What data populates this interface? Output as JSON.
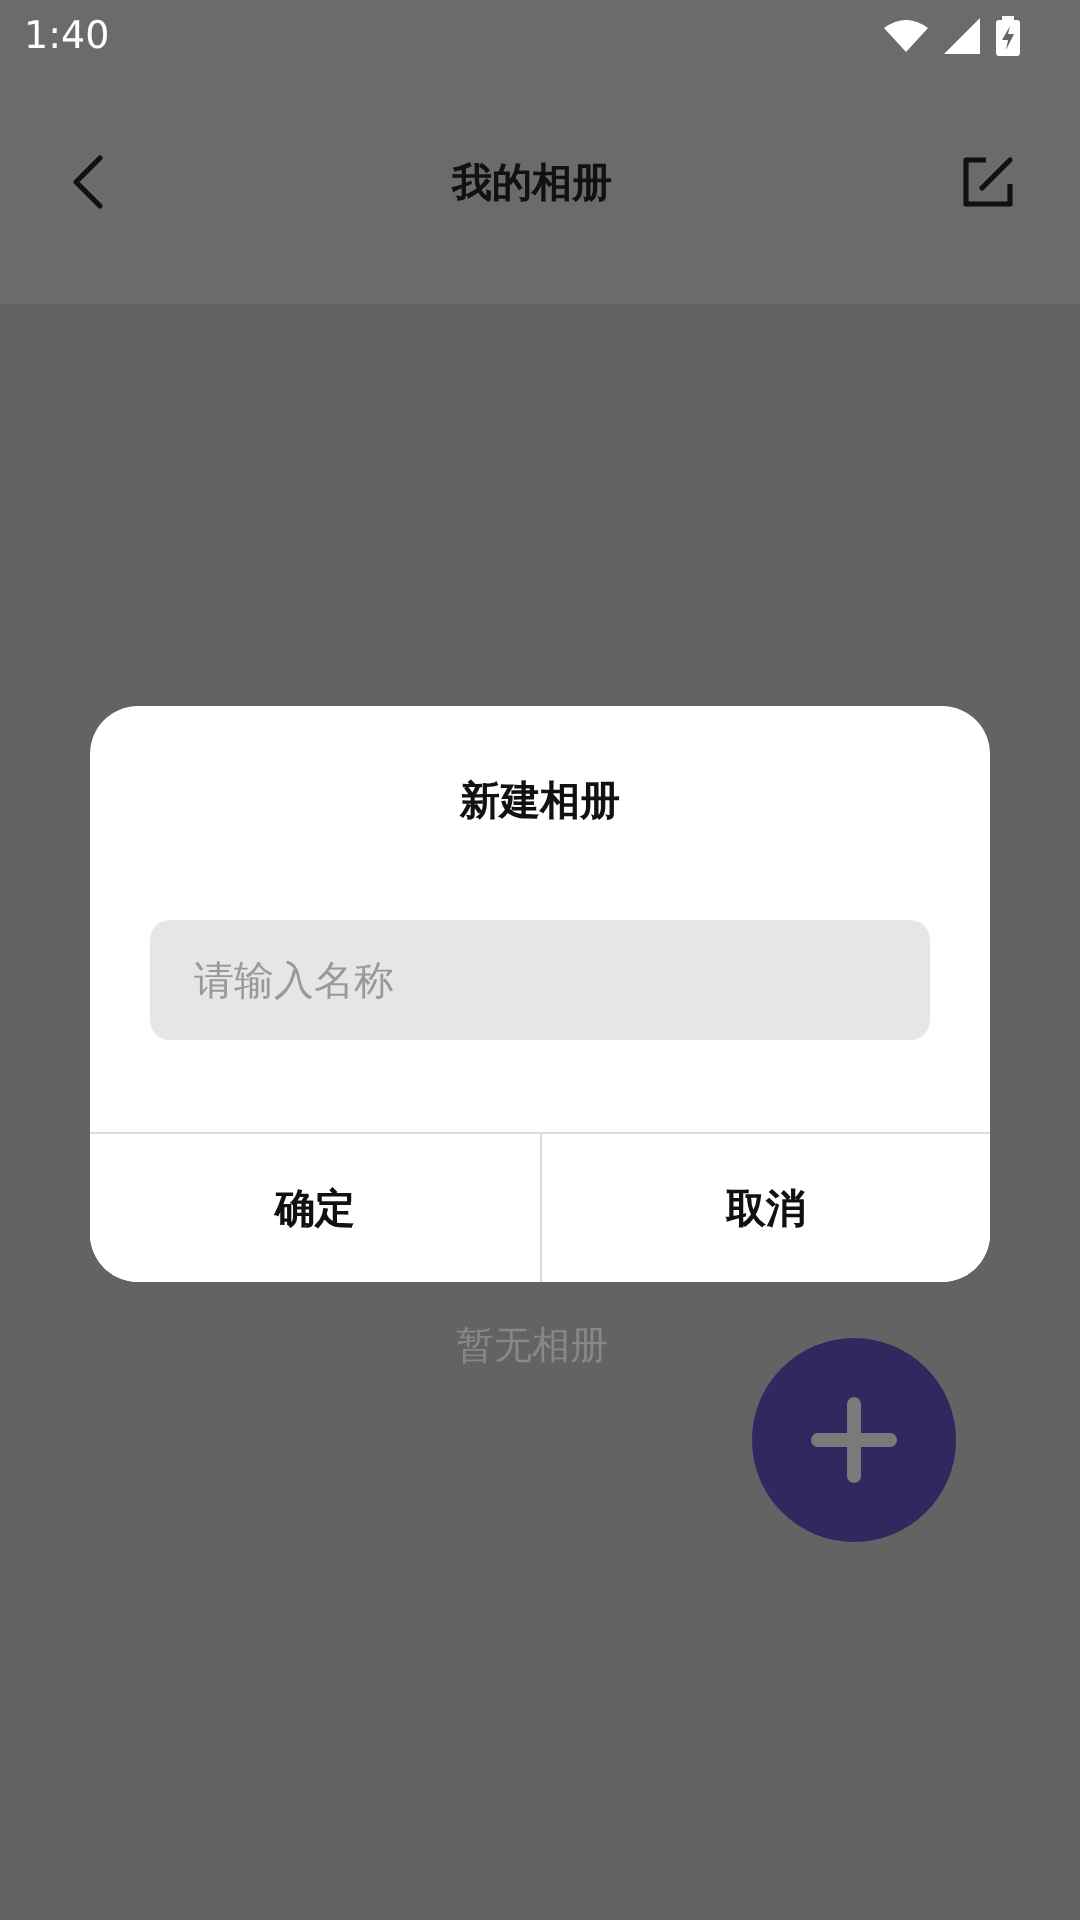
{
  "status_bar": {
    "time": "1:40"
  },
  "header": {
    "title": "我的相册"
  },
  "empty_state": {
    "text": "暂无相册"
  },
  "dialog": {
    "title": "新建相册",
    "input": {
      "placeholder": "请输入名称"
    },
    "buttons": [
      {
        "label": "确定"
      },
      {
        "label": "取消"
      }
    ]
  }
}
